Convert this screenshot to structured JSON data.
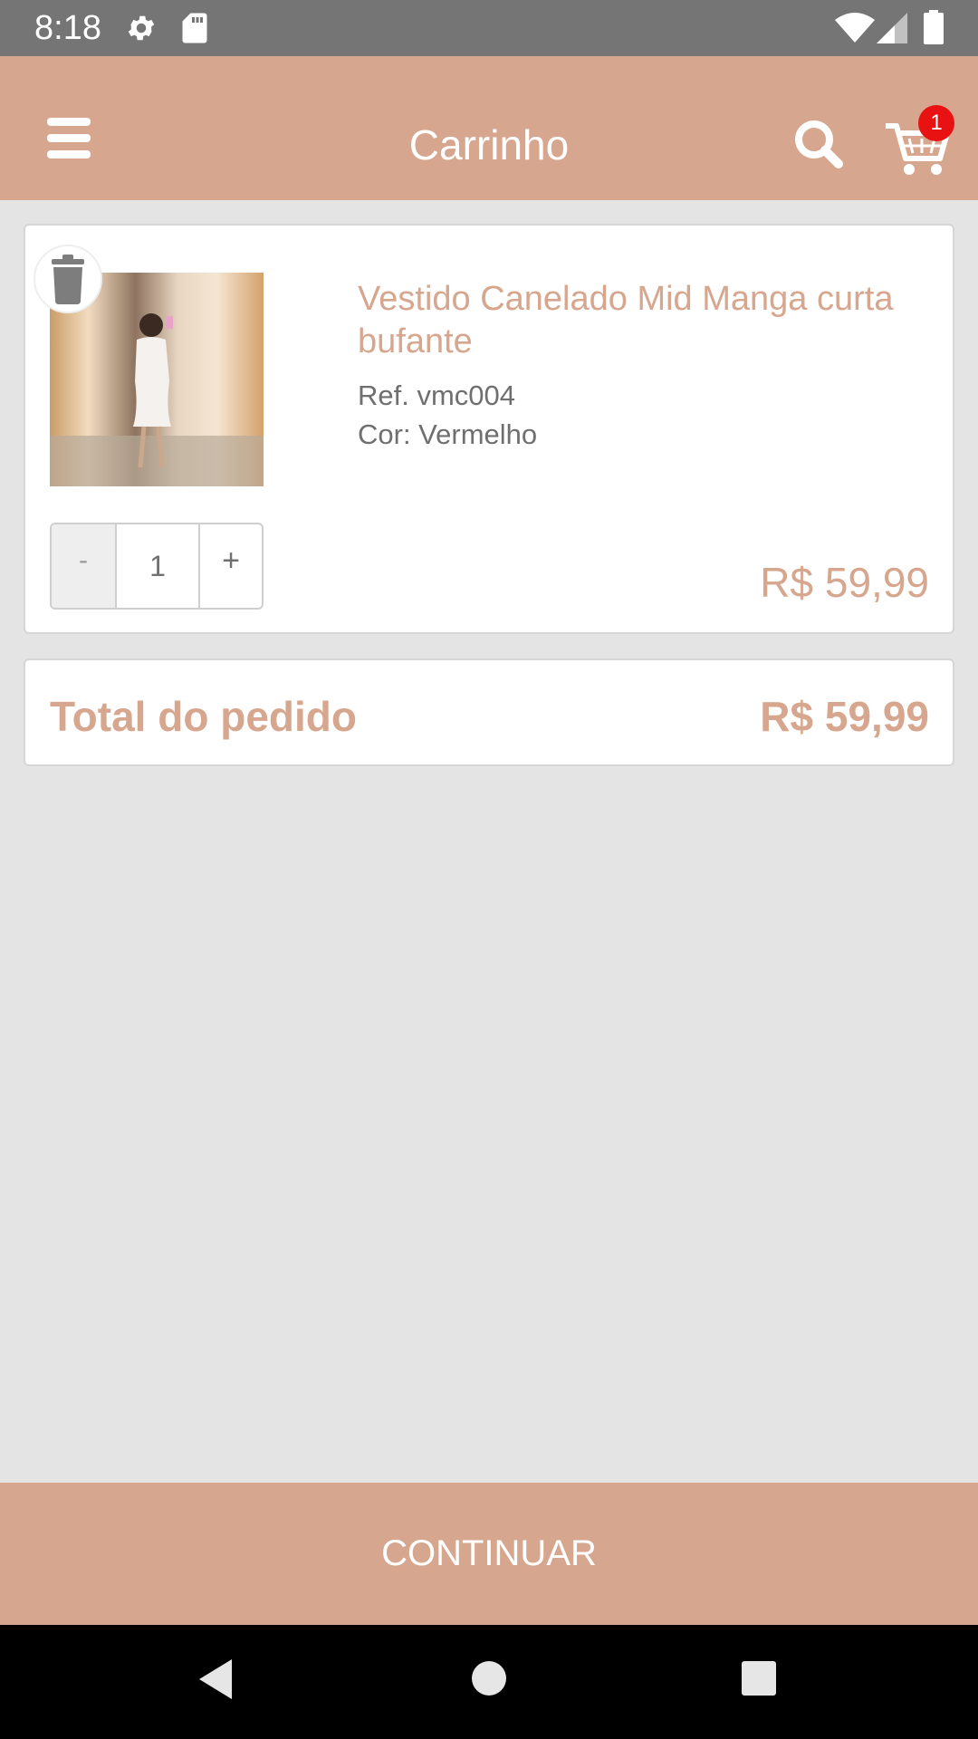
{
  "status_bar": {
    "time": "8:18",
    "icons": [
      "settings-icon",
      "sd-card-icon",
      "wifi-icon",
      "signal-icon",
      "battery-icon"
    ]
  },
  "app_bar": {
    "title": "Carrinho",
    "menu_icon": "hamburger-menu-icon",
    "search_icon": "search-icon",
    "cart_icon": "cart-icon",
    "cart_badge": "1"
  },
  "cart_item": {
    "name": "Vestido Canelado Mid Manga curta bufante",
    "ref": "Ref. vmc004",
    "color": "Cor: Vermelho",
    "quantity": "1",
    "minus_label": "-",
    "plus_label": "+",
    "price": "R$ 59,99",
    "delete_icon": "trash-icon"
  },
  "order_total": {
    "label": "Total do pedido",
    "value": "R$ 59,99"
  },
  "continue_button": {
    "label": "CONTINUAR"
  },
  "navigation_bar": {
    "icons": [
      "back-icon",
      "home-icon",
      "recents-icon"
    ]
  },
  "colors": {
    "accent": "#d6a68e",
    "badge": "#e81212",
    "background": "#e4e4e4",
    "status_bar": "#757575"
  }
}
